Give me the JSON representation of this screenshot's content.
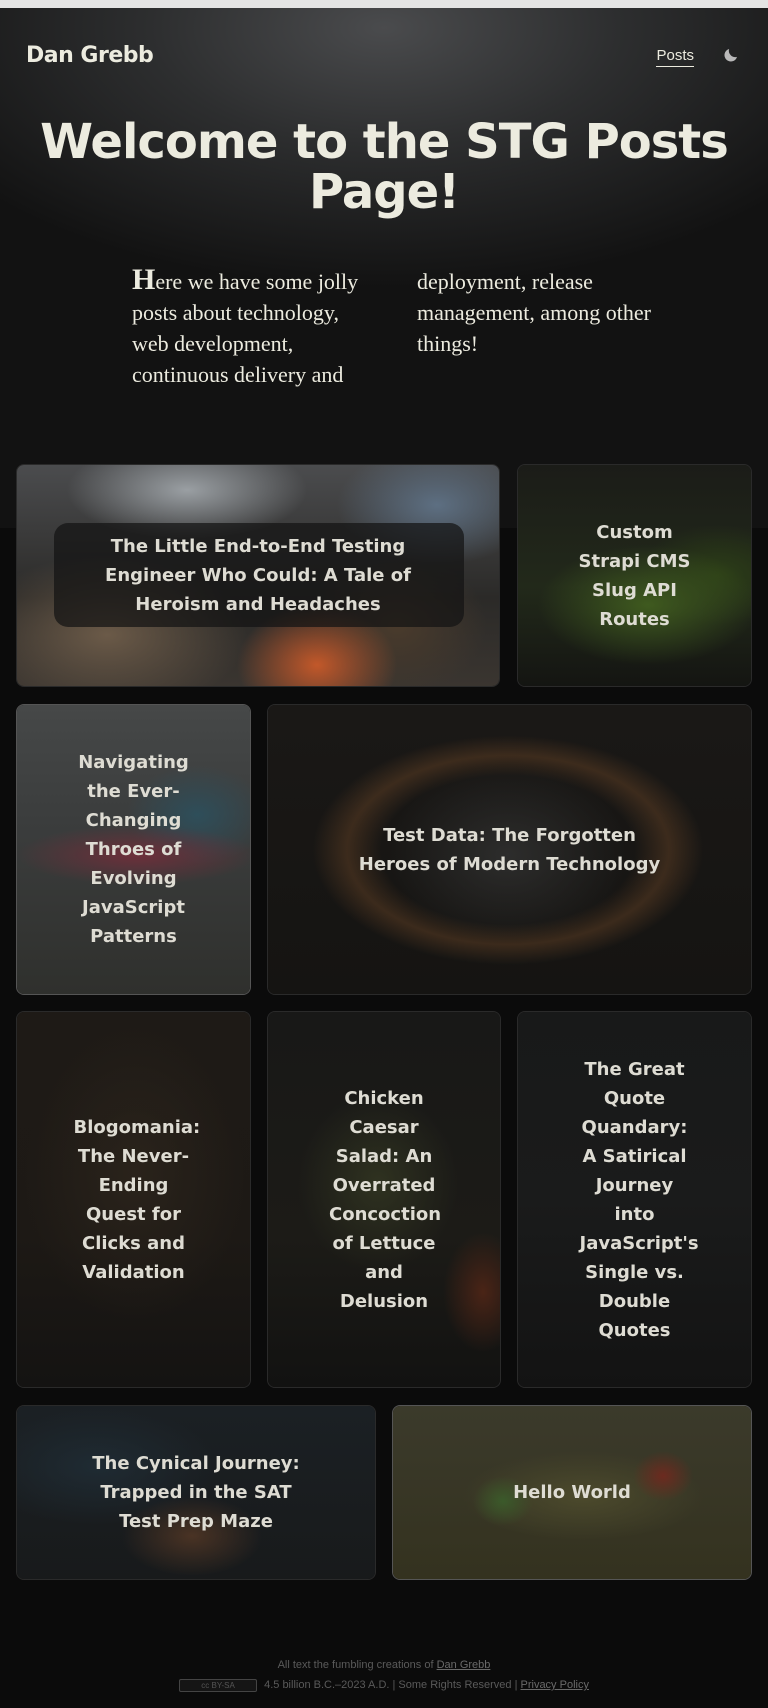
{
  "header": {
    "logo": "Dan Grebb",
    "nav_posts": "Posts",
    "theme_icon": "moon-icon"
  },
  "hero": {
    "title": "Welcome to the STG Posts Page!",
    "intro_dropcap": "H",
    "intro_rest": "ere we have some jolly posts about technology, web development, continuous delivery and deployment, release management, among other things!"
  },
  "posts": [
    {
      "title": "The Little End-to-End Testing Engineer Who Could: A Tale of Heroism and Headaches"
    },
    {
      "title": "Custom Strapi CMS Slug API Routes"
    },
    {
      "title": "Navigating the Ever-Changing Throes of Evolving JavaScript Patterns"
    },
    {
      "title": "Test Data: The Forgotten Heroes of Modern Technology"
    },
    {
      "title": "Blogomania: The Never-Ending Quest for Clicks and Validation"
    },
    {
      "title": "Chicken Caesar Salad: An Overrated Concoction of Lettuce and Delusion"
    },
    {
      "title": "The Great Quote Quandary: A Satirical Journey into JavaScript's Single vs. Double Quotes"
    },
    {
      "title": "The Cynical Journey: Trapped in the SAT Test Prep Maze"
    },
    {
      "title": "Hello World"
    }
  ],
  "footer": {
    "line1_prefix": "All text the fumbling creations of",
    "author_link": "Dan Grebb",
    "license_badge": "cc BY-SA",
    "line2_text": "4.5 billion B.C.–2023 A.D. | Some Rights Reserved |",
    "privacy_link": "Privacy Policy"
  }
}
